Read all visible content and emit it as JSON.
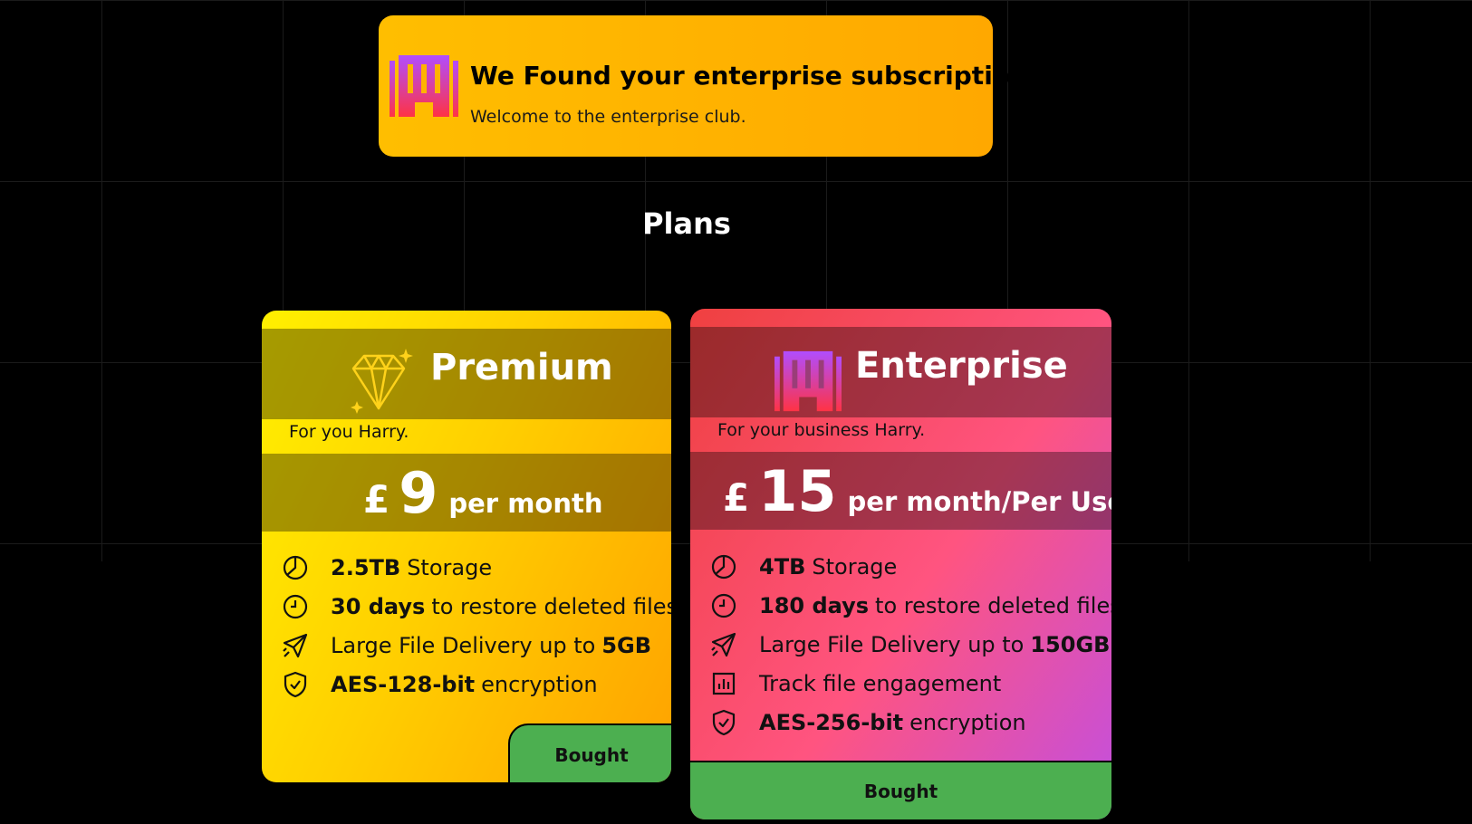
{
  "notice": {
    "title": "We Found your enterprise subscription",
    "subtitle": "Welcome to the enterprise club.",
    "icon": "building-icon"
  },
  "plans_title": "Plans",
  "plans": [
    {
      "name": "Premium",
      "icon": "diamond-icon",
      "tagline": "For you Harry.",
      "currency": "£",
      "price": "9",
      "period": "per month",
      "features": [
        {
          "icon": "pie-chart-icon",
          "bold": "2.5TB",
          "rest": "Storage",
          "order": "bold-first"
        },
        {
          "icon": "clock-icon",
          "bold": "30 days",
          "rest": "to restore deleted files",
          "order": "bold-first"
        },
        {
          "icon": "send-icon",
          "bold": "5GB",
          "rest": "Large File Delivery up to",
          "order": "rest-first"
        },
        {
          "icon": "shield-check-icon",
          "bold": "AES-128-bit",
          "rest": "encryption",
          "order": "bold-first"
        }
      ],
      "button_label": "Bought",
      "colors": {
        "from": "#fff000",
        "to": "#ffa200"
      }
    },
    {
      "name": "Enterprise",
      "icon": "building-icon",
      "tagline": "For your business Harry.",
      "currency": "£",
      "price": "15",
      "period": "per month/Per User",
      "features": [
        {
          "icon": "pie-chart-icon",
          "bold": "4TB",
          "rest": "Storage",
          "order": "bold-first"
        },
        {
          "icon": "clock-icon",
          "bold": "180 days",
          "rest": "to restore deleted files",
          "order": "bold-first"
        },
        {
          "icon": "send-icon",
          "bold": "150GB",
          "rest": "Large File Delivery up to",
          "order": "rest-first"
        },
        {
          "icon": "bar-chart-icon",
          "bold": "",
          "rest": "Track file engagement",
          "order": "rest-first"
        },
        {
          "icon": "shield-check-icon",
          "bold": "AES-256-bit",
          "rest": "encryption",
          "order": "bold-first"
        }
      ],
      "button_label": "Bought",
      "colors": {
        "from": "#ef4040",
        "to": "#c24fe0"
      }
    }
  ],
  "button_color": "#4caf50"
}
